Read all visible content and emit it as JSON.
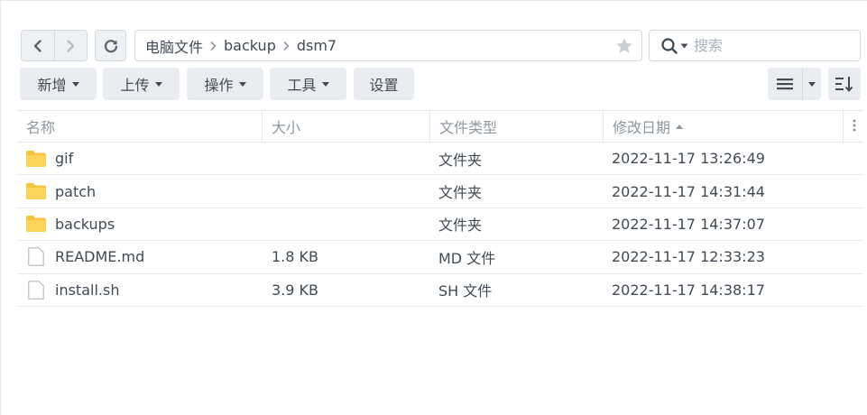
{
  "nav": {
    "back_icon": "chevron-left-icon",
    "forward_icon": "chevron-right-icon",
    "refresh_icon": "refresh-icon"
  },
  "path": {
    "crumbs": [
      "电脑文件",
      "backup",
      "dsm7"
    ],
    "favorite_icon": "star-icon"
  },
  "search": {
    "placeholder": "搜索",
    "icon": "search-icon"
  },
  "toolbar": {
    "create_label": "新增",
    "upload_label": "上传",
    "action_label": "操作",
    "tools_label": "工具",
    "settings_label": "设置",
    "view_icon": "list-view-icon",
    "sort_icon": "sort-icon"
  },
  "table": {
    "columns": {
      "name": "名称",
      "size": "大小",
      "type": "文件类型",
      "modified": "修改日期"
    },
    "rows": [
      {
        "name": "gif",
        "size": "",
        "type": "文件夹",
        "modified": "2022-11-17 13:26:49",
        "icon": "folder-icon"
      },
      {
        "name": "patch",
        "size": "",
        "type": "文件夹",
        "modified": "2022-11-17 14:31:44",
        "icon": "folder-icon"
      },
      {
        "name": "backups",
        "size": "",
        "type": "文件夹",
        "modified": "2022-11-17 14:37:07",
        "icon": "folder-icon"
      },
      {
        "name": "README.md",
        "size": "1.8 KB",
        "type": "MD 文件",
        "modified": "2022-11-17 12:33:23",
        "icon": "file-icon"
      },
      {
        "name": "install.sh",
        "size": "3.9 KB",
        "type": "SH 文件",
        "modified": "2022-11-17 14:38:17",
        "icon": "file-icon"
      }
    ]
  },
  "colors": {
    "folder": "#f7c53c",
    "button_bg": "#e9edf1",
    "border": "#d4dae0",
    "text": "#414b55",
    "muted": "#8e98a2"
  }
}
